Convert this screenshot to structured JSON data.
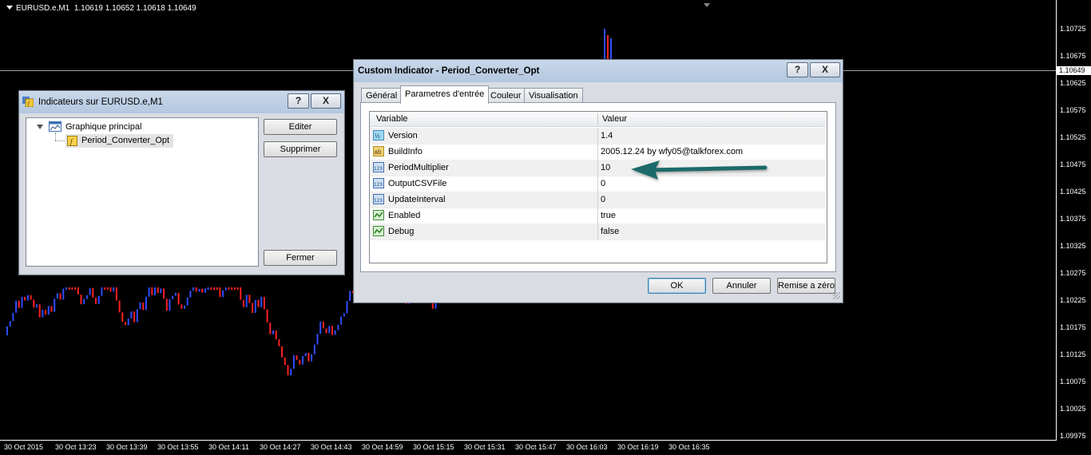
{
  "chart": {
    "symbol": "EURUSD.e,M1",
    "ohlc": "1.10619 1.10652 1.10618 1.10649",
    "current_price": "1.10649",
    "price_labels": [
      "1.10725",
      "1.10675",
      "1.10625",
      "1.10575",
      "1.10525",
      "1.10475",
      "1.10425",
      "1.10375",
      "1.10325",
      "1.10275",
      "1.10225",
      "1.10175",
      "1.10125",
      "1.10075",
      "1.10025",
      "1.09975"
    ],
    "time_labels": [
      "30 Oct 2015",
      "30 Oct 13:23",
      "30 Oct 13:39",
      "30 Oct 13:55",
      "30 Oct 14:11",
      "30 Oct 14:27",
      "30 Oct 14:43",
      "30 Oct 14:59",
      "30 Oct 15:15",
      "30 Oct 15:31",
      "30 Oct 15:47",
      "30 Oct 16:03",
      "30 Oct 16:19",
      "30 Oct 16:35"
    ],
    "bull_color": "#2e4dff",
    "bear_color": "#ff2020"
  },
  "indicators_window": {
    "title": "Indicateurs sur EURUSD.e,M1",
    "help_label": "?",
    "close_label": "X",
    "tree": {
      "root_label": "Graphique principal",
      "child_label": "Period_Converter_Opt"
    },
    "buttons": {
      "edit": "Editer",
      "delete": "Supprimer",
      "close": "Fermer"
    }
  },
  "custom_dialog": {
    "title": "Custom Indicator - Period_Converter_Opt",
    "help_label": "?",
    "close_label": "X",
    "tabs": [
      "Général",
      "Parametres d'entrée",
      "Couleur",
      "Visualisation"
    ],
    "active_tab": 1,
    "columns": {
      "variable": "Variable",
      "value": "Valeur"
    },
    "rows": [
      {
        "name": "Version",
        "value": "1.4",
        "icon": "double-type-icon"
      },
      {
        "name": "BuildInfo",
        "value": "2005.12.24 by wfy05@talkforex.com",
        "icon": "string-type-icon"
      },
      {
        "name": "PeriodMultiplier",
        "value": "10",
        "icon": "int-type-icon"
      },
      {
        "name": "OutputCSVFile",
        "value": "0",
        "icon": "int-type-icon"
      },
      {
        "name": "UpdateInterval",
        "value": "0",
        "icon": "int-type-icon"
      },
      {
        "name": "Enabled",
        "value": "true",
        "icon": "bool-type-icon"
      },
      {
        "name": "Debug",
        "value": "false",
        "icon": "bool-type-icon"
      }
    ],
    "buttons": {
      "ok": "OK",
      "cancel": "Annuler",
      "reset": "Remise a zéro"
    },
    "annotation_arrow_color": "#1f6b6b"
  }
}
